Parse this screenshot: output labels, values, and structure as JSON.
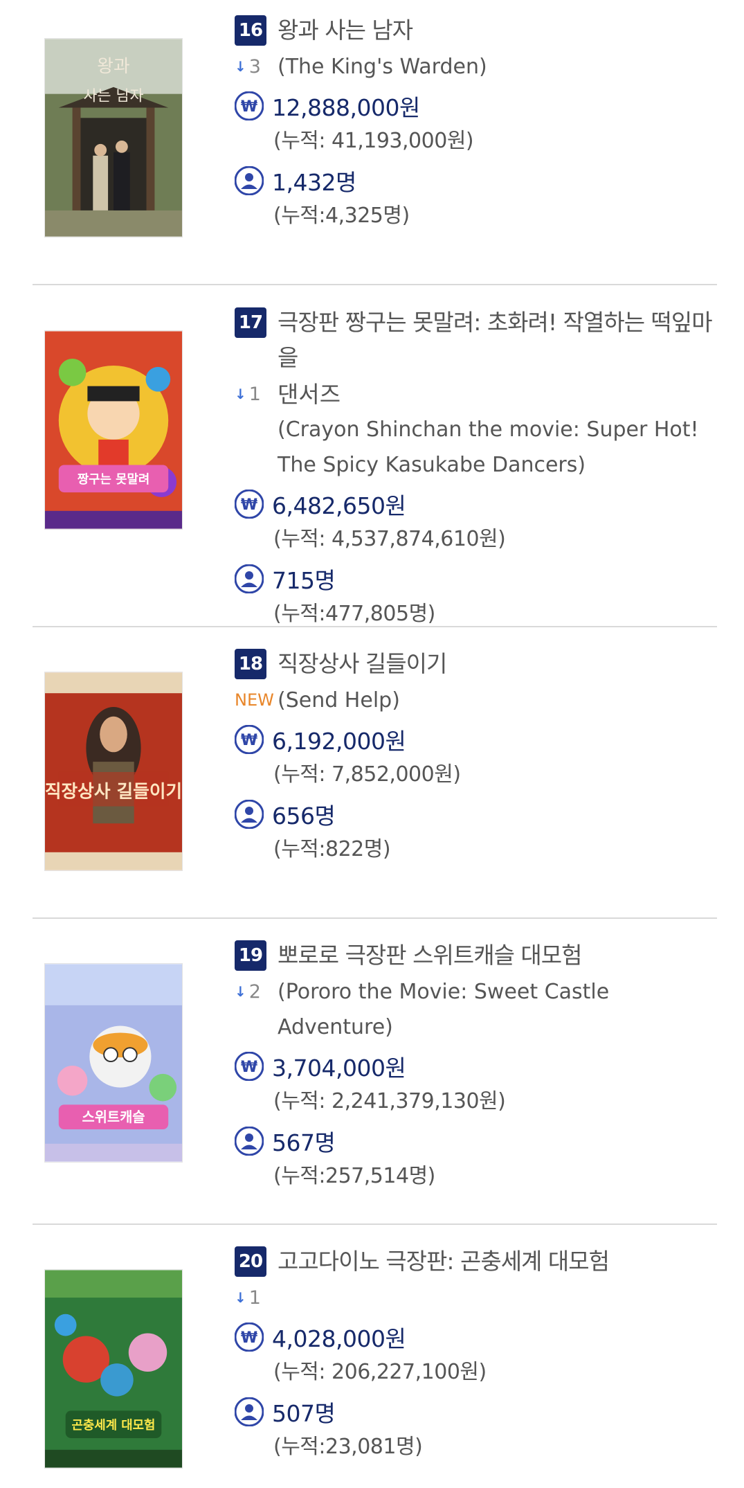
{
  "entries": [
    {
      "rank": "16",
      "title_ko": "왕과 사는 남자",
      "change_label": "3",
      "change_type": "down",
      "title_en_lines": [
        "(The King's Warden)"
      ],
      "revenue": "12,888,000원",
      "revenue_total": "(누적: 41,193,000원)",
      "audience": "1,432명",
      "audience_total": "(누적:4,325명)",
      "poster": {
        "bg": "#6f7d55",
        "accent": "#4a3a2a",
        "text_color": "#f0e8d8"
      }
    },
    {
      "rank": "17",
      "title_ko_lines": [
        "극장판 짱구는 못말려: 초화려! 작열하는 떡잎마을",
        "댄서즈"
      ],
      "change_label": "1",
      "change_type": "down",
      "title_en_lines": [
        "(Crayon Shinchan the movie: Super Hot!",
        "The Spicy Kasukabe Dancers)"
      ],
      "revenue": "6,482,650원",
      "revenue_total": "(누적: 4,537,874,610원)",
      "audience": "715명",
      "audience_total": "(누적:477,805명)",
      "poster": {
        "bg": "#d9482b",
        "accent": "#f2c230",
        "text_color": "#ffffff"
      }
    },
    {
      "rank": "18",
      "title_ko": "직장상사 길들이기",
      "change_label": "NEW",
      "change_type": "new",
      "title_en_lines": [
        "(Send Help)"
      ],
      "revenue": "6,192,000원",
      "revenue_total": "(누적: 7,852,000원)",
      "audience": "656명",
      "audience_total": "(누적:822명)",
      "poster": {
        "bg": "#b5341f",
        "accent": "#3b2a22",
        "text_color": "#ffe6c2"
      }
    },
    {
      "rank": "19",
      "title_ko": "뽀로로 극장판 스위트캐슬 대모험",
      "change_label": "2",
      "change_type": "down",
      "title_en_lines": [
        "(Pororo the Movie: Sweet Castle",
        "Adventure)"
      ],
      "revenue": "3,704,000원",
      "revenue_total": "(누적: 2,241,379,130원)",
      "audience": "567명",
      "audience_total": "(누적:257,514명)",
      "poster": {
        "bg": "#a9b6e8",
        "accent": "#e85fb0",
        "text_color": "#ffffff"
      }
    },
    {
      "rank": "20",
      "title_ko": "고고다이노 극장판: 곤충세계 대모험",
      "change_label": "1",
      "change_type": "down",
      "title_en_lines": [],
      "revenue": "4,028,000원",
      "revenue_total": "(누적: 206,227,100원)",
      "audience": "507명",
      "audience_total": "(누적:23,081명)",
      "poster": {
        "bg": "#2f7a3a",
        "accent": "#d8412f",
        "text_color": "#ffe94a"
      }
    }
  ],
  "icons": {
    "revenue": "won-coin-icon",
    "audience": "person-icon",
    "change_down": "down-arrow-icon"
  },
  "colors": {
    "badge": "#16296a",
    "value": "#16296a",
    "new": "#e8862a",
    "arrow": "#3d6fd6",
    "icon": "#2f46a8"
  }
}
